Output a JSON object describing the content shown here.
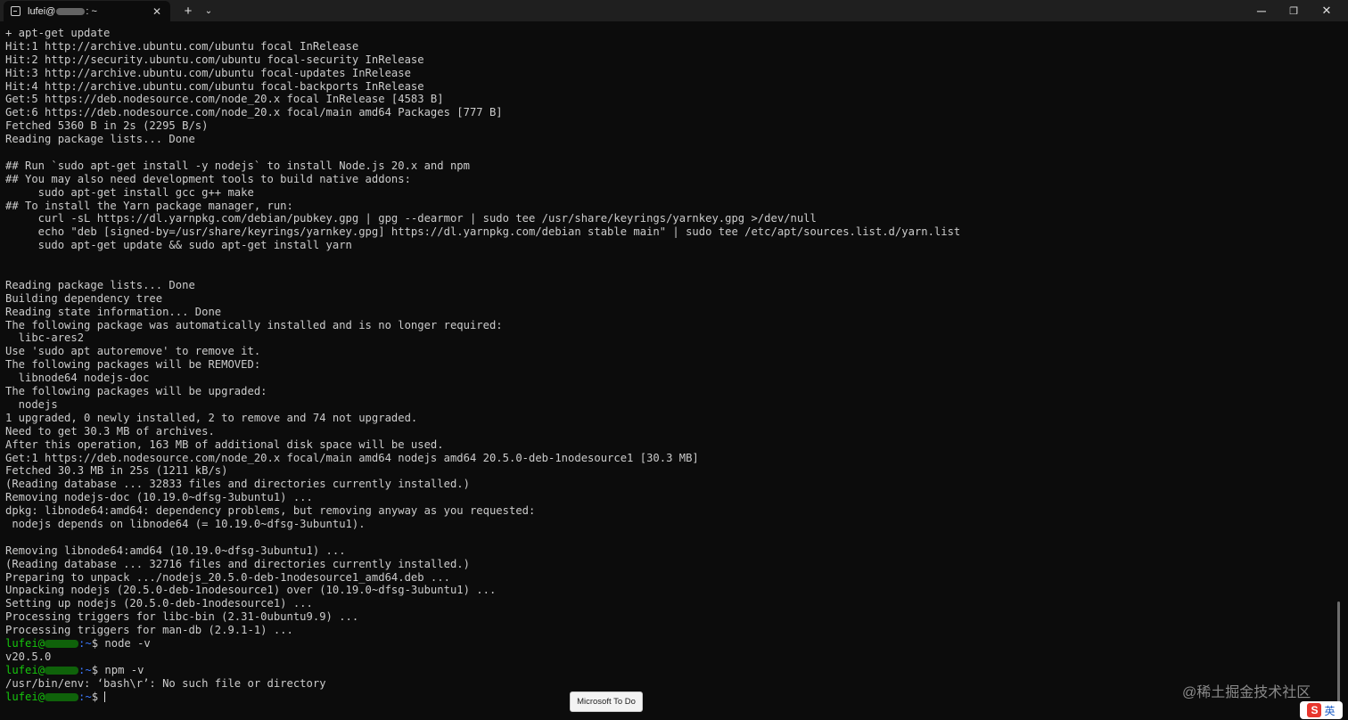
{
  "window": {
    "tab_title_prefix": "lufei@",
    "tab_title_suffix": ": ~",
    "close_tab_icon": "close-icon",
    "new_tab_icon": "plus-icon",
    "dropdown_icon": "chevron-down-icon",
    "minimize_icon": "minimize-icon",
    "maximize_icon": "maximize-icon",
    "close_window_icon": "close-icon"
  },
  "terminal": {
    "lines": [
      "+ apt-get update",
      "Hit:1 http://archive.ubuntu.com/ubuntu focal InRelease",
      "Hit:2 http://security.ubuntu.com/ubuntu focal-security InRelease",
      "Hit:3 http://archive.ubuntu.com/ubuntu focal-updates InRelease",
      "Hit:4 http://archive.ubuntu.com/ubuntu focal-backports InRelease",
      "Get:5 https://deb.nodesource.com/node_20.x focal InRelease [4583 B]",
      "Get:6 https://deb.nodesource.com/node_20.x focal/main amd64 Packages [777 B]",
      "Fetched 5360 B in 2s (2295 B/s)",
      "Reading package lists... Done",
      "",
      "## Run `sudo apt-get install -y nodejs` to install Node.js 20.x and npm",
      "## You may also need development tools to build native addons:",
      "     sudo apt-get install gcc g++ make",
      "## To install the Yarn package manager, run:",
      "     curl -sL https://dl.yarnpkg.com/debian/pubkey.gpg | gpg --dearmor | sudo tee /usr/share/keyrings/yarnkey.gpg >/dev/null",
      "     echo \"deb [signed-by=/usr/share/keyrings/yarnkey.gpg] https://dl.yarnpkg.com/debian stable main\" | sudo tee /etc/apt/sources.list.d/yarn.list",
      "     sudo apt-get update && sudo apt-get install yarn",
      "",
      "",
      "Reading package lists... Done",
      "Building dependency tree",
      "Reading state information... Done",
      "The following package was automatically installed and is no longer required:",
      "  libc-ares2",
      "Use 'sudo apt autoremove' to remove it.",
      "The following packages will be REMOVED:",
      "  libnode64 nodejs-doc",
      "The following packages will be upgraded:",
      "  nodejs",
      "1 upgraded, 0 newly installed, 2 to remove and 74 not upgraded.",
      "Need to get 30.3 MB of archives.",
      "After this operation, 163 MB of additional disk space will be used.",
      "Get:1 https://deb.nodesource.com/node_20.x focal/main amd64 nodejs amd64 20.5.0-deb-1nodesource1 [30.3 MB]",
      "Fetched 30.3 MB in 25s (1211 kB/s)",
      "(Reading database ... 32833 files and directories currently installed.)",
      "Removing nodejs-doc (10.19.0~dfsg-3ubuntu1) ...",
      "dpkg: libnode64:amd64: dependency problems, but removing anyway as you requested:",
      " nodejs depends on libnode64 (= 10.19.0~dfsg-3ubuntu1).",
      "",
      "Removing libnode64:amd64 (10.19.0~dfsg-3ubuntu1) ...",
      "(Reading database ... 32716 files and directories currently installed.)",
      "Preparing to unpack .../nodejs_20.5.0-deb-1nodesource1_amd64.deb ...",
      "Unpacking nodejs (20.5.0-deb-1nodesource1) over (10.19.0~dfsg-3ubuntu1) ...",
      "Setting up nodejs (20.5.0-deb-1nodesource1) ...",
      "Processing triggers for libc-bin (2.31-0ubuntu9.9) ...",
      "Processing triggers for man-db (2.9.1-1) ..."
    ],
    "prompt": {
      "user": "lufei@",
      "path": ":~",
      "symbol": "$ "
    },
    "session": [
      {
        "command": "node -v",
        "output": "v20.5.0"
      },
      {
        "command": "npm -v",
        "output": "/usr/bin/env: ‘bash\\r’: No such file or directory"
      }
    ]
  },
  "toast": {
    "label": "Microsoft To Do"
  },
  "watermark": {
    "text": "@稀土掘金技术社区"
  },
  "ime": {
    "logo": "S",
    "lang": "英"
  }
}
